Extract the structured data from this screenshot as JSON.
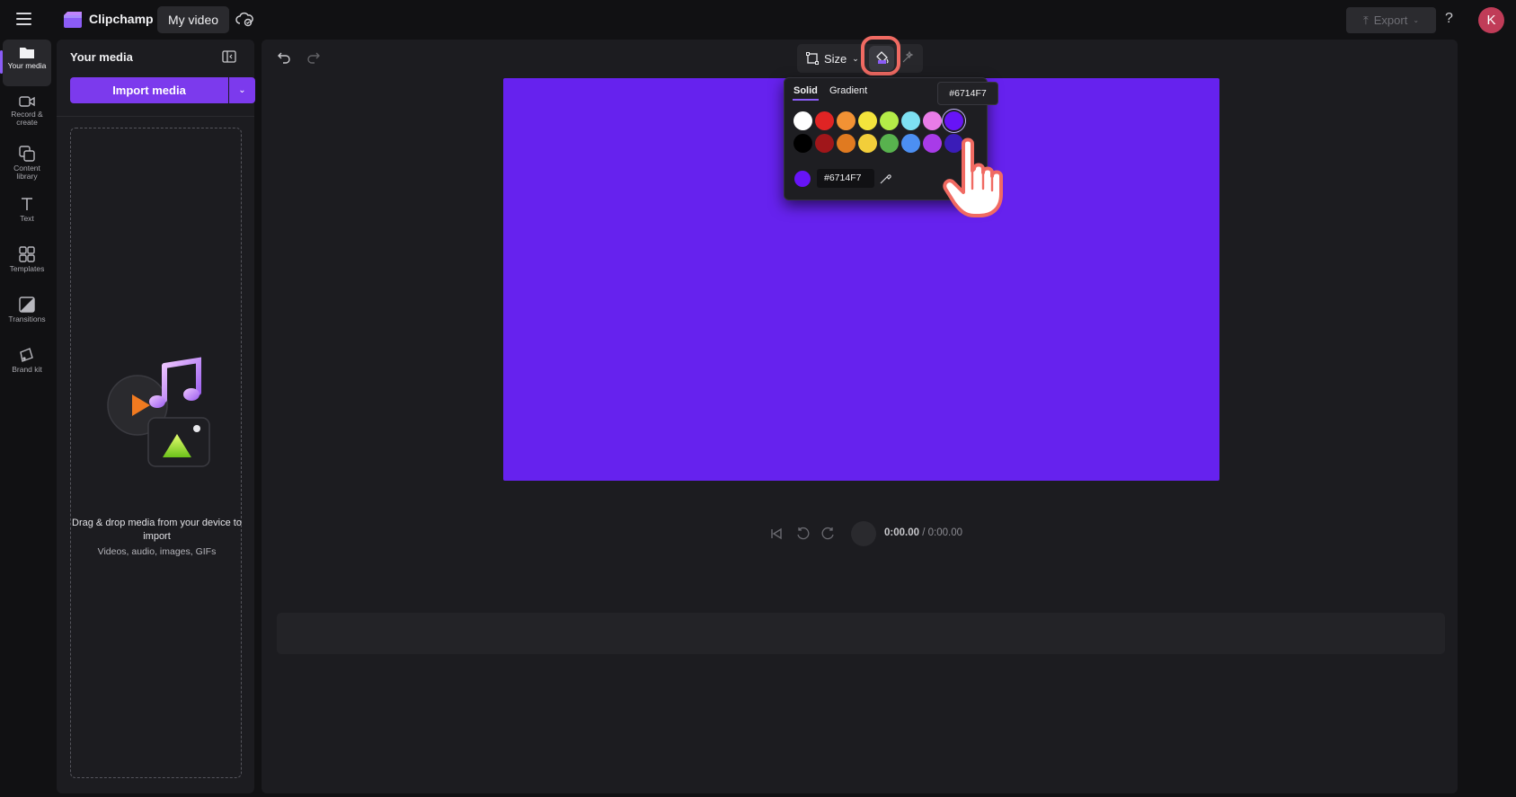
{
  "topbar": {
    "app_name": "Clipchamp",
    "video_title": "My video",
    "export_label": "Export",
    "help_label": "?",
    "avatar_initial": "K"
  },
  "rail": {
    "items": [
      {
        "label": "Your media",
        "icon": "folder-icon"
      },
      {
        "label": "Record & create",
        "icon": "camera-icon"
      },
      {
        "label": "Content library",
        "icon": "library-icon"
      },
      {
        "label": "Text",
        "icon": "text-icon"
      },
      {
        "label": "Templates",
        "icon": "templates-icon"
      },
      {
        "label": "Transitions",
        "icon": "transitions-icon"
      },
      {
        "label": "Brand kit",
        "icon": "brand-kit-icon"
      }
    ]
  },
  "media_panel": {
    "title": "Your media",
    "import_label": "Import media",
    "drop_title": "Drag & drop media from your device to import",
    "drop_subtitle": "Videos, audio, images, GIFs"
  },
  "editor": {
    "size_label": "Size",
    "canvas_color": "#6622EE"
  },
  "color_picker": {
    "tabs": [
      "Solid",
      "Gradient"
    ],
    "active_tab": "Solid",
    "hex_value": "#6714F7",
    "tooltip": "#6714F7",
    "swatches_row1": [
      "#FFFFFF",
      "#E02424",
      "#F29234",
      "#F4E43C",
      "#B4EC48",
      "#7EE0F2",
      "#E97CE8",
      "#6714F7"
    ],
    "swatches_row2": [
      "#000000",
      "#A0161A",
      "#E07A20",
      "#F2CE3A",
      "#58B24E",
      "#4C8FF2",
      "#A83BE8",
      "#3A1CB8"
    ],
    "selected_swatch": "#6714F7"
  },
  "playback": {
    "current_time": "0:00.00",
    "separator": "/",
    "total_time": "0:00.00"
  }
}
